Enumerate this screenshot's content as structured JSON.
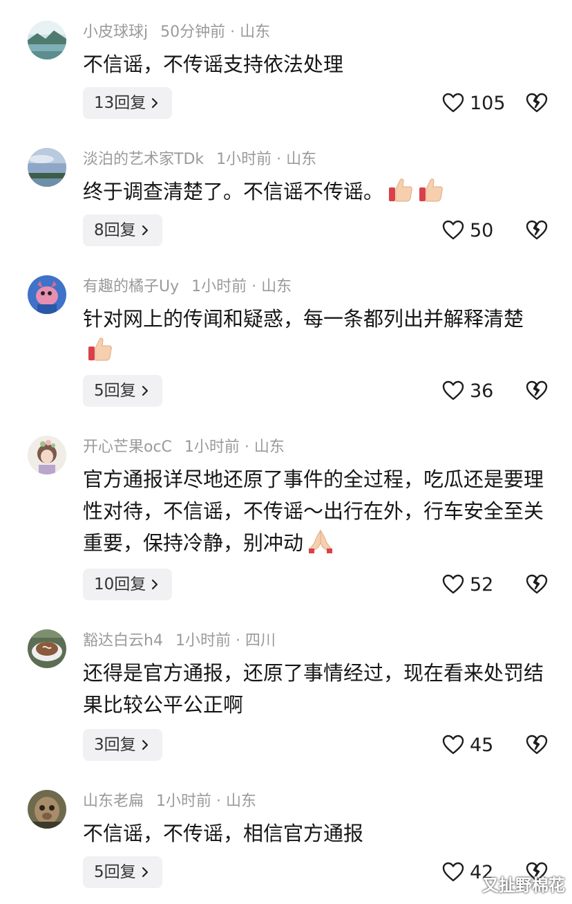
{
  "comments": [
    {
      "username": "小皮球球j",
      "time": "50分钟前",
      "location": "山东",
      "text": "不信谣，不传谣支持依法处理",
      "emoji": "",
      "replies": "13回复",
      "likes": "105"
    },
    {
      "username": "淡泊的艺术家TDk",
      "time": "1小时前",
      "location": "山东",
      "text": "终于调查清楚了。不信谣不传谣。",
      "emoji": "thumbs-up-x2",
      "replies": "8回复",
      "likes": "50"
    },
    {
      "username": "有趣的橘子Uy",
      "time": "1小时前",
      "location": "山东",
      "text": "针对网上的传闻和疑惑，每一条都列出并解释清楚",
      "emoji": "thumbs-up",
      "replies": "5回复",
      "likes": "36"
    },
    {
      "username": "开心芒果ocC",
      "time": "1小时前",
      "location": "山东",
      "text": "官方通报详尽地还原了事件的全过程，吃瓜还是要理性对待，不信谣，不传谣～出行在外，行车安全至关重要，保持冷静，别冲动",
      "emoji": "folded-hands",
      "replies": "10回复",
      "likes": "52"
    },
    {
      "username": "豁达白云h4",
      "time": "1小时前",
      "location": "四川",
      "text": "还得是官方通报，还原了事情经过，现在看来处罚结果比较公平公正啊",
      "emoji": "",
      "replies": "3回复",
      "likes": "45"
    },
    {
      "username": "山东老扁",
      "time": "1小时前",
      "location": "山东",
      "text": "不信谣，不传谣，相信官方通报",
      "emoji": "",
      "replies": "5回复",
      "likes": "42"
    }
  ],
  "watermark": "又扯野棉花",
  "dot": "·"
}
